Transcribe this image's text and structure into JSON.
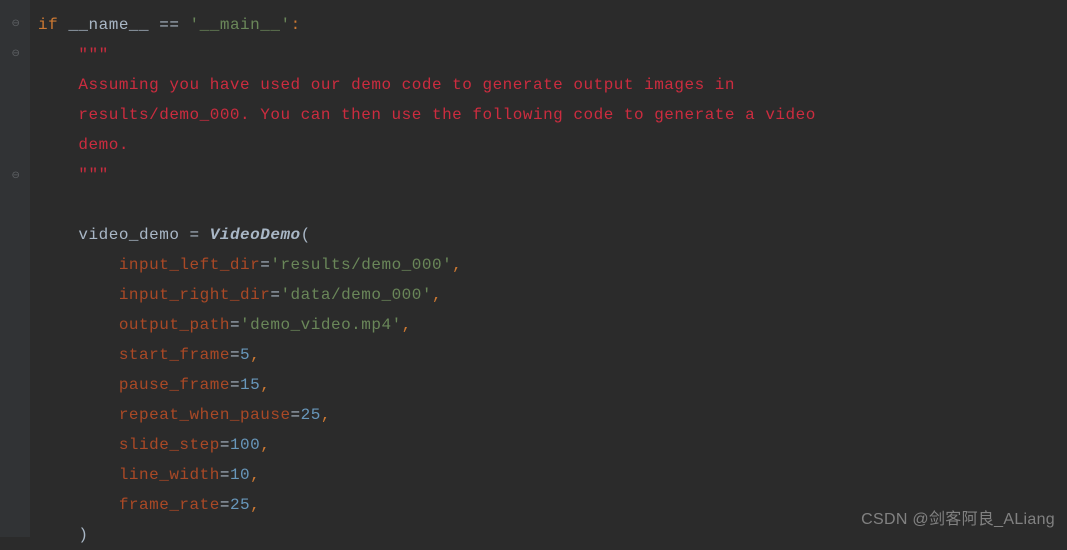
{
  "code": {
    "if_keyword": "if",
    "name_dunder": "__name__",
    "eq_op": "==",
    "main_string": "'__main__'",
    "colon": ":",
    "triple_quote_open": "\"\"\"",
    "docstring_line1": "Assuming you have used our demo code to generate output images in",
    "docstring_line2": "results/demo_000. You can then use the following code to generate a video",
    "docstring_line3": "demo.",
    "triple_quote_close": "\"\"\"",
    "var_name": "video_demo",
    "assign_op": " = ",
    "class_name": "VideoDemo",
    "open_paren": "(",
    "params": {
      "input_left_dir": {
        "name": "input_left_dir",
        "value": "'results/demo_000'"
      },
      "input_right_dir": {
        "name": "input_right_dir",
        "value": "'data/demo_000'"
      },
      "output_path": {
        "name": "output_path",
        "value": "'demo_video.mp4'"
      },
      "start_frame": {
        "name": "start_frame",
        "value": "5"
      },
      "pause_frame": {
        "name": "pause_frame",
        "value": "15"
      },
      "repeat_when_pause": {
        "name": "repeat_when_pause",
        "value": "25"
      },
      "slide_step": {
        "name": "slide_step",
        "value": "100"
      },
      "line_width": {
        "name": "line_width",
        "value": "10"
      },
      "frame_rate": {
        "name": "frame_rate",
        "value": "25"
      }
    },
    "close_paren": ")"
  },
  "watermark": "CSDN @剑客阿良_ALiang"
}
